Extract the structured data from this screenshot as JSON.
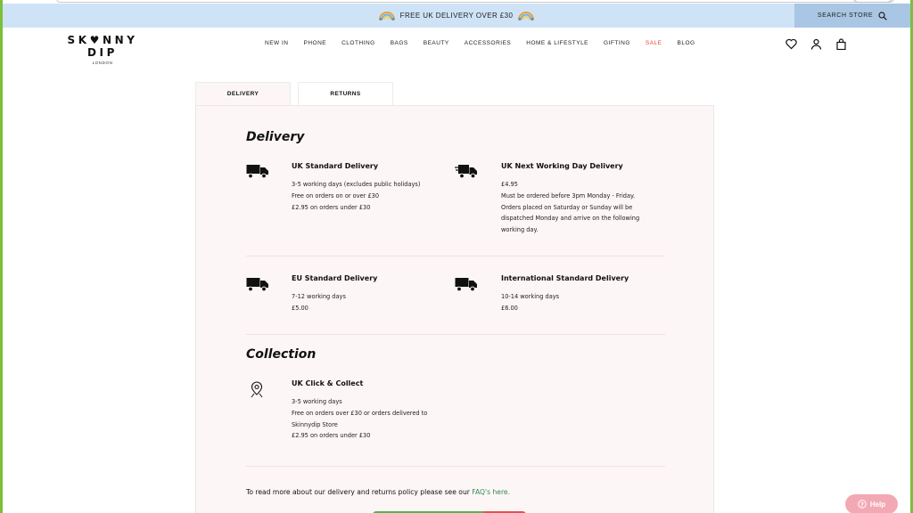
{
  "announcement": {
    "text": "FREE UK DELIVERY OVER £30"
  },
  "search_store": {
    "label": "SEARCH STORE"
  },
  "logo": {
    "main": "SK♥NNY DIP",
    "sub": "LONDON"
  },
  "nav": {
    "items": [
      "NEW IN",
      "PHONE",
      "CLOTHING",
      "BAGS",
      "BEAUTY",
      "ACCESSORIES",
      "HOME & LIFESTYLE",
      "GIFTING",
      "SALE",
      "BLOG"
    ]
  },
  "tabs": {
    "delivery": "DELIVERY",
    "returns": "RETURNS"
  },
  "delivery": {
    "heading": "Delivery",
    "uk_standard": {
      "title": "UK Standard Delivery",
      "lines": [
        "3-5 working days (excludes public holidays)",
        "Free on orders on or over £30",
        "£2.95 on orders under £30"
      ]
    },
    "uk_next": {
      "title": "UK Next Working Day Delivery",
      "lines": [
        "£4.95",
        "Must be ordered before 3pm Monday - Friday.",
        "Orders placed on Saturday or Sunday will be",
        "dispatched Monday and arrive on the following",
        "working day."
      ]
    },
    "eu_standard": {
      "title": "EU Standard Delivery",
      "lines": [
        "7-12 working days",
        "£5.00"
      ]
    },
    "international": {
      "title": "International Standard Delivery",
      "lines": [
        "10-14 working days",
        "£6.00"
      ]
    }
  },
  "collection": {
    "heading": "Collection",
    "click_collect": {
      "title": "UK Click & Collect",
      "lines": [
        "3-5 working days",
        "Free on orders over £30 or orders delivered to",
        "Skinnydip Store",
        "£2.95 on orders under £30"
      ]
    }
  },
  "footer": {
    "note": "To read more about our delivery and returns policy please see our ",
    "link": "FAQ's here."
  },
  "help": {
    "label": "Help"
  },
  "colors": {
    "sale": "#e0463c",
    "link": "#2e8b57",
    "announce_bg": "#cfe3f7",
    "help_bg": "#f3a9b4"
  }
}
